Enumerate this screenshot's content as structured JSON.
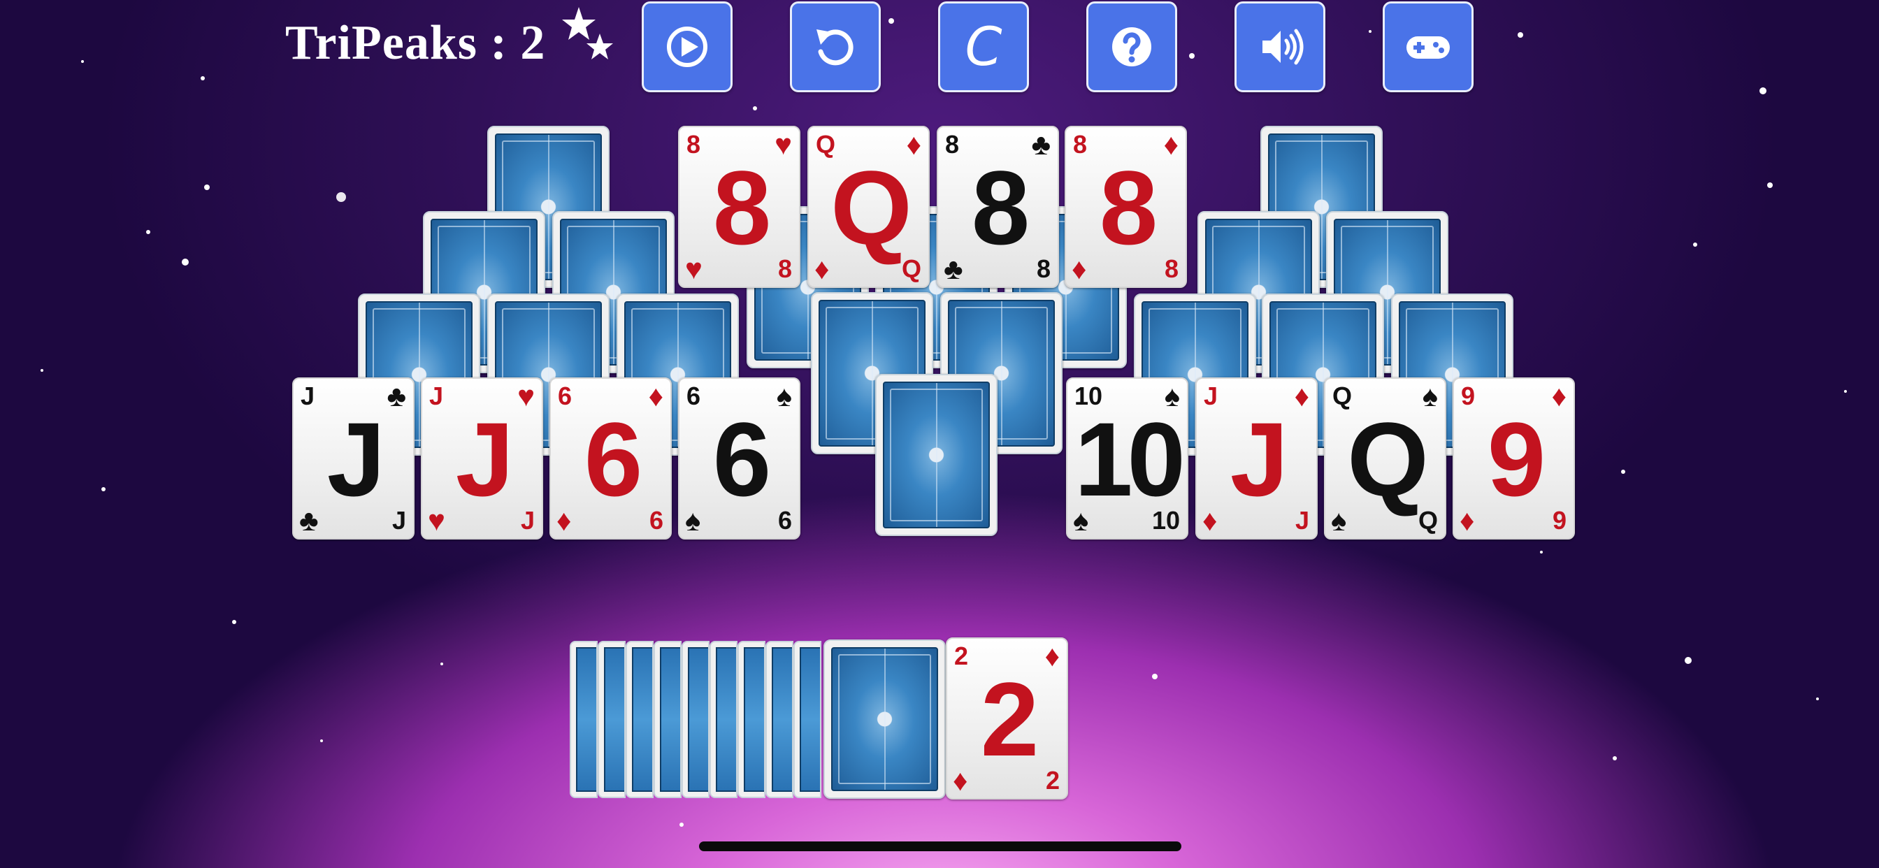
{
  "header": {
    "title": "TriPeaks : 2",
    "buttons": [
      {
        "name": "play-button",
        "icon": "play-circle-icon"
      },
      {
        "name": "undo-button",
        "icon": "undo-icon"
      },
      {
        "name": "restart-button",
        "icon": "c-letter-icon",
        "label": "C"
      },
      {
        "name": "help-button",
        "icon": "question-icon"
      },
      {
        "name": "sound-button",
        "icon": "speaker-icon"
      },
      {
        "name": "games-button",
        "icon": "gamepad-icon"
      }
    ]
  },
  "colors": {
    "button": "#4a73e8",
    "red_suit": "#c3131f",
    "black_suit": "#111111"
  },
  "tableau": {
    "top_row": [
      {
        "rank": "8",
        "suit": "♥",
        "color": "red"
      },
      {
        "rank": "Q",
        "suit": "♦",
        "color": "red"
      },
      {
        "rank": "8",
        "suit": "♣",
        "color": "black"
      },
      {
        "rank": "8",
        "suit": "♦",
        "color": "red"
      }
    ],
    "bottom_left": [
      {
        "rank": "J",
        "suit": "♣",
        "color": "black"
      },
      {
        "rank": "J",
        "suit": "♥",
        "color": "red"
      },
      {
        "rank": "6",
        "suit": "♦",
        "color": "red"
      },
      {
        "rank": "6",
        "suit": "♠",
        "color": "black"
      }
    ],
    "bottom_right": [
      {
        "rank": "10",
        "suit": "♠",
        "color": "black"
      },
      {
        "rank": "J",
        "suit": "♦",
        "color": "red"
      },
      {
        "rank": "Q",
        "suit": "♠",
        "color": "black"
      },
      {
        "rank": "9",
        "suit": "♦",
        "color": "red"
      }
    ]
  },
  "waste": {
    "rank": "2",
    "suit": "♦",
    "color": "red"
  }
}
